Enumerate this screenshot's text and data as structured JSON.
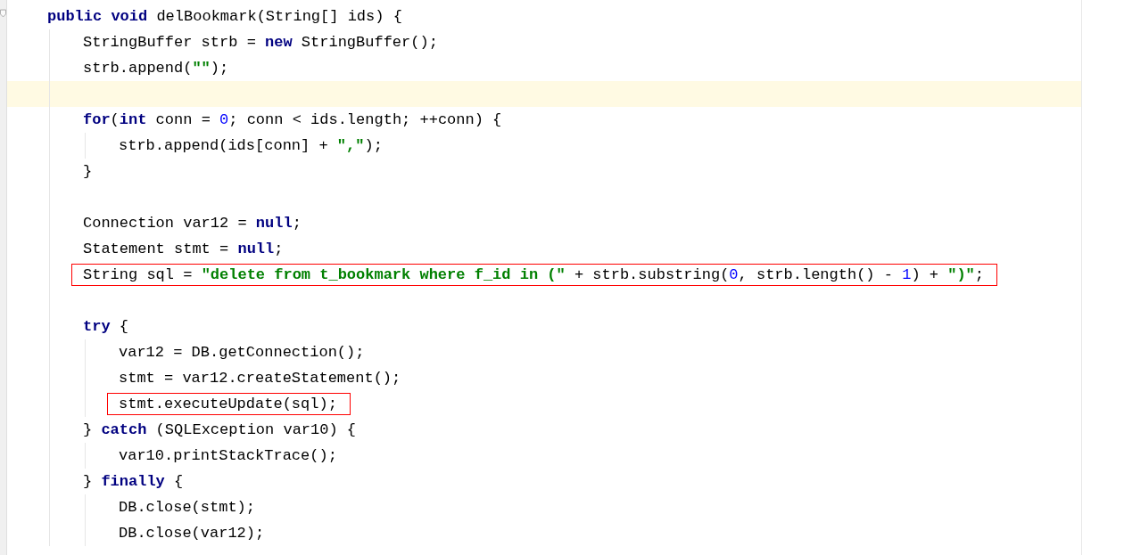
{
  "editor": {
    "lines": [
      {
        "kind": "code",
        "tokens": [
          {
            "kind": "kw",
            "text": "public void"
          },
          {
            "kind": "plain",
            "text": " delBookmark(String[] ids) {"
          }
        ],
        "foldable": true,
        "children": [
          {
            "kind": "code",
            "tokens": [
              {
                "kind": "plain",
                "text": "StringBuffer strb = "
              },
              {
                "kind": "kw",
                "text": "new"
              },
              {
                "kind": "plain",
                "text": " StringBuffer();"
              }
            ]
          },
          {
            "kind": "code",
            "tokens": [
              {
                "kind": "plain",
                "text": "strb.append("
              },
              {
                "kind": "str",
                "text": "\"\""
              },
              {
                "kind": "plain",
                "text": ");"
              }
            ]
          },
          {
            "kind": "blank",
            "current": true
          },
          {
            "kind": "code",
            "tokens": [
              {
                "kind": "kw",
                "text": "for"
              },
              {
                "kind": "plain",
                "text": "("
              },
              {
                "kind": "kw",
                "text": "int"
              },
              {
                "kind": "plain",
                "text": " conn = "
              },
              {
                "kind": "num",
                "text": "0"
              },
              {
                "kind": "plain",
                "text": "; conn < ids.length; ++conn) {"
              }
            ],
            "children": [
              {
                "kind": "code",
                "tokens": [
                  {
                    "kind": "plain",
                    "text": "strb.append(ids[conn] + "
                  },
                  {
                    "kind": "str",
                    "text": "\",\""
                  },
                  {
                    "kind": "plain",
                    "text": ");"
                  }
                ]
              }
            ]
          },
          {
            "kind": "code",
            "tokens": [
              {
                "kind": "plain",
                "text": "}"
              }
            ]
          },
          {
            "kind": "blank"
          },
          {
            "kind": "code",
            "tokens": [
              {
                "kind": "plain",
                "text": "Connection var12 = "
              },
              {
                "kind": "kw",
                "text": "null"
              },
              {
                "kind": "plain",
                "text": ";"
              }
            ]
          },
          {
            "kind": "code",
            "tokens": [
              {
                "kind": "plain",
                "text": "Statement stmt = "
              },
              {
                "kind": "kw",
                "text": "null"
              },
              {
                "kind": "plain",
                "text": ";"
              }
            ]
          },
          {
            "kind": "code",
            "tokens": [
              {
                "kind": "plain",
                "text": "String sql = "
              },
              {
                "kind": "str",
                "text": "\"delete from t_bookmark where f_id in (\""
              },
              {
                "kind": "plain",
                "text": " + strb.substring("
              },
              {
                "kind": "num",
                "text": "0"
              },
              {
                "kind": "plain",
                "text": ", strb.length() - "
              },
              {
                "kind": "num",
                "text": "1"
              },
              {
                "kind": "plain",
                "text": ") + "
              },
              {
                "kind": "str",
                "text": "\")\""
              },
              {
                "kind": "plain",
                "text": ";"
              }
            ],
            "boxed": true
          },
          {
            "kind": "blank"
          },
          {
            "kind": "code",
            "tokens": [
              {
                "kind": "kw",
                "text": "try"
              },
              {
                "kind": "plain",
                "text": " {"
              }
            ],
            "children": [
              {
                "kind": "code",
                "tokens": [
                  {
                    "kind": "plain",
                    "text": "var12 = DB.getConnection();"
                  }
                ]
              },
              {
                "kind": "code",
                "tokens": [
                  {
                    "kind": "plain",
                    "text": "stmt = var12.createStatement();"
                  }
                ]
              },
              {
                "kind": "code",
                "tokens": [
                  {
                    "kind": "plain",
                    "text": "stmt.executeUpdate(sql);"
                  }
                ],
                "boxed": true
              }
            ]
          },
          {
            "kind": "code",
            "tokens": [
              {
                "kind": "plain",
                "text": "} "
              },
              {
                "kind": "kw",
                "text": "catch"
              },
              {
                "kind": "plain",
                "text": " (SQLException var10) {"
              }
            ],
            "children": [
              {
                "kind": "code",
                "tokens": [
                  {
                    "kind": "plain",
                    "text": "var10.printStackTrace();"
                  }
                ]
              }
            ]
          },
          {
            "kind": "code",
            "tokens": [
              {
                "kind": "plain",
                "text": "} "
              },
              {
                "kind": "kw",
                "text": "finally"
              },
              {
                "kind": "plain",
                "text": " {"
              }
            ],
            "children": [
              {
                "kind": "code",
                "tokens": [
                  {
                    "kind": "plain",
                    "text": "DB.close(stmt);"
                  }
                ]
              },
              {
                "kind": "code",
                "tokens": [
                  {
                    "kind": "plain",
                    "text": "DB.close(var12);"
                  }
                ]
              }
            ]
          }
        ]
      }
    ]
  }
}
